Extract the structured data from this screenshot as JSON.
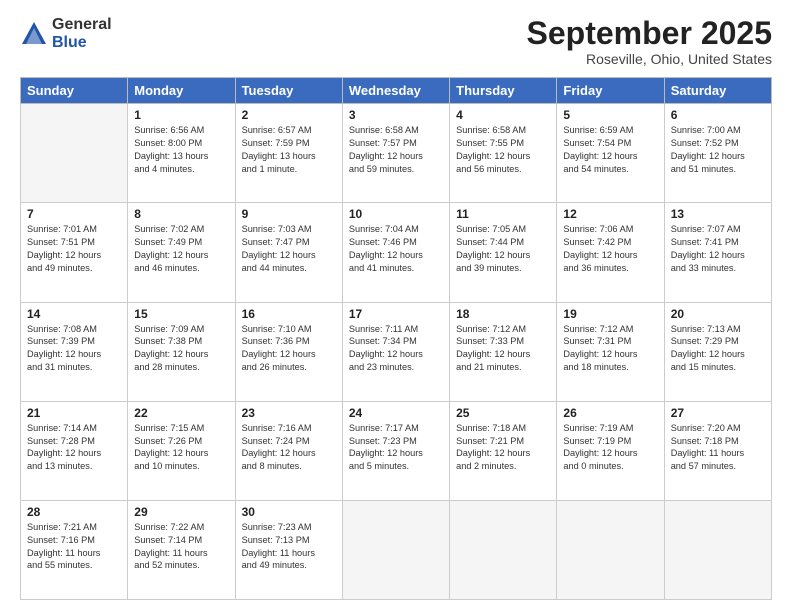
{
  "logo": {
    "general": "General",
    "blue": "Blue"
  },
  "header": {
    "month": "September 2025",
    "location": "Roseville, Ohio, United States"
  },
  "weekdays": [
    "Sunday",
    "Monday",
    "Tuesday",
    "Wednesday",
    "Thursday",
    "Friday",
    "Saturday"
  ],
  "weeks": [
    [
      {
        "day": "",
        "lines": []
      },
      {
        "day": "1",
        "lines": [
          "Sunrise: 6:56 AM",
          "Sunset: 8:00 PM",
          "Daylight: 13 hours",
          "and 4 minutes."
        ]
      },
      {
        "day": "2",
        "lines": [
          "Sunrise: 6:57 AM",
          "Sunset: 7:59 PM",
          "Daylight: 13 hours",
          "and 1 minute."
        ]
      },
      {
        "day": "3",
        "lines": [
          "Sunrise: 6:58 AM",
          "Sunset: 7:57 PM",
          "Daylight: 12 hours",
          "and 59 minutes."
        ]
      },
      {
        "day": "4",
        "lines": [
          "Sunrise: 6:58 AM",
          "Sunset: 7:55 PM",
          "Daylight: 12 hours",
          "and 56 minutes."
        ]
      },
      {
        "day": "5",
        "lines": [
          "Sunrise: 6:59 AM",
          "Sunset: 7:54 PM",
          "Daylight: 12 hours",
          "and 54 minutes."
        ]
      },
      {
        "day": "6",
        "lines": [
          "Sunrise: 7:00 AM",
          "Sunset: 7:52 PM",
          "Daylight: 12 hours",
          "and 51 minutes."
        ]
      }
    ],
    [
      {
        "day": "7",
        "lines": [
          "Sunrise: 7:01 AM",
          "Sunset: 7:51 PM",
          "Daylight: 12 hours",
          "and 49 minutes."
        ]
      },
      {
        "day": "8",
        "lines": [
          "Sunrise: 7:02 AM",
          "Sunset: 7:49 PM",
          "Daylight: 12 hours",
          "and 46 minutes."
        ]
      },
      {
        "day": "9",
        "lines": [
          "Sunrise: 7:03 AM",
          "Sunset: 7:47 PM",
          "Daylight: 12 hours",
          "and 44 minutes."
        ]
      },
      {
        "day": "10",
        "lines": [
          "Sunrise: 7:04 AM",
          "Sunset: 7:46 PM",
          "Daylight: 12 hours",
          "and 41 minutes."
        ]
      },
      {
        "day": "11",
        "lines": [
          "Sunrise: 7:05 AM",
          "Sunset: 7:44 PM",
          "Daylight: 12 hours",
          "and 39 minutes."
        ]
      },
      {
        "day": "12",
        "lines": [
          "Sunrise: 7:06 AM",
          "Sunset: 7:42 PM",
          "Daylight: 12 hours",
          "and 36 minutes."
        ]
      },
      {
        "day": "13",
        "lines": [
          "Sunrise: 7:07 AM",
          "Sunset: 7:41 PM",
          "Daylight: 12 hours",
          "and 33 minutes."
        ]
      }
    ],
    [
      {
        "day": "14",
        "lines": [
          "Sunrise: 7:08 AM",
          "Sunset: 7:39 PM",
          "Daylight: 12 hours",
          "and 31 minutes."
        ]
      },
      {
        "day": "15",
        "lines": [
          "Sunrise: 7:09 AM",
          "Sunset: 7:38 PM",
          "Daylight: 12 hours",
          "and 28 minutes."
        ]
      },
      {
        "day": "16",
        "lines": [
          "Sunrise: 7:10 AM",
          "Sunset: 7:36 PM",
          "Daylight: 12 hours",
          "and 26 minutes."
        ]
      },
      {
        "day": "17",
        "lines": [
          "Sunrise: 7:11 AM",
          "Sunset: 7:34 PM",
          "Daylight: 12 hours",
          "and 23 minutes."
        ]
      },
      {
        "day": "18",
        "lines": [
          "Sunrise: 7:12 AM",
          "Sunset: 7:33 PM",
          "Daylight: 12 hours",
          "and 21 minutes."
        ]
      },
      {
        "day": "19",
        "lines": [
          "Sunrise: 7:12 AM",
          "Sunset: 7:31 PM",
          "Daylight: 12 hours",
          "and 18 minutes."
        ]
      },
      {
        "day": "20",
        "lines": [
          "Sunrise: 7:13 AM",
          "Sunset: 7:29 PM",
          "Daylight: 12 hours",
          "and 15 minutes."
        ]
      }
    ],
    [
      {
        "day": "21",
        "lines": [
          "Sunrise: 7:14 AM",
          "Sunset: 7:28 PM",
          "Daylight: 12 hours",
          "and 13 minutes."
        ]
      },
      {
        "day": "22",
        "lines": [
          "Sunrise: 7:15 AM",
          "Sunset: 7:26 PM",
          "Daylight: 12 hours",
          "and 10 minutes."
        ]
      },
      {
        "day": "23",
        "lines": [
          "Sunrise: 7:16 AM",
          "Sunset: 7:24 PM",
          "Daylight: 12 hours",
          "and 8 minutes."
        ]
      },
      {
        "day": "24",
        "lines": [
          "Sunrise: 7:17 AM",
          "Sunset: 7:23 PM",
          "Daylight: 12 hours",
          "and 5 minutes."
        ]
      },
      {
        "day": "25",
        "lines": [
          "Sunrise: 7:18 AM",
          "Sunset: 7:21 PM",
          "Daylight: 12 hours",
          "and 2 minutes."
        ]
      },
      {
        "day": "26",
        "lines": [
          "Sunrise: 7:19 AM",
          "Sunset: 7:19 PM",
          "Daylight: 12 hours",
          "and 0 minutes."
        ]
      },
      {
        "day": "27",
        "lines": [
          "Sunrise: 7:20 AM",
          "Sunset: 7:18 PM",
          "Daylight: 11 hours",
          "and 57 minutes."
        ]
      }
    ],
    [
      {
        "day": "28",
        "lines": [
          "Sunrise: 7:21 AM",
          "Sunset: 7:16 PM",
          "Daylight: 11 hours",
          "and 55 minutes."
        ]
      },
      {
        "day": "29",
        "lines": [
          "Sunrise: 7:22 AM",
          "Sunset: 7:14 PM",
          "Daylight: 11 hours",
          "and 52 minutes."
        ]
      },
      {
        "day": "30",
        "lines": [
          "Sunrise: 7:23 AM",
          "Sunset: 7:13 PM",
          "Daylight: 11 hours",
          "and 49 minutes."
        ]
      },
      {
        "day": "",
        "lines": []
      },
      {
        "day": "",
        "lines": []
      },
      {
        "day": "",
        "lines": []
      },
      {
        "day": "",
        "lines": []
      }
    ]
  ]
}
